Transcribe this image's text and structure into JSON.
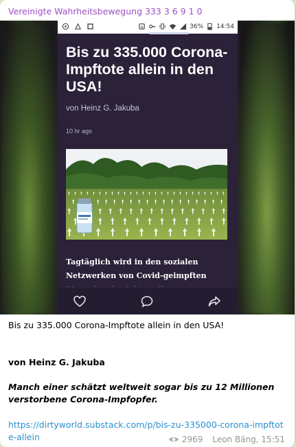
{
  "channel": {
    "name": "Vereinigte Wahrheitsbewegung 333 3 6 9 1 0"
  },
  "screenshot": {
    "status_bar": {
      "battery": "36%",
      "time": "14:54"
    },
    "article": {
      "headline": "Bis zu 335.000 Corona-Impftote allein in den USA!",
      "byline": "von Heinz G. Jakuba",
      "time_ago": "10 hr ago",
      "intro": "Tagtäglich wird in den sozialen Netzwerken von Covid-geimpften Menschen berichtet, die unerwartet plötzlich"
    },
    "actions": {
      "like_icon": "heart-icon",
      "comment_icon": "comment-icon",
      "share_icon": "share-icon"
    }
  },
  "caption": {
    "title": "Bis zu 335.000 Corona-Impftote allein in den USA!",
    "author": "von Heinz G. Jakuba",
    "quote": "Manch einer schätzt weltweit sogar bis zu 12 Millionen verstorbene Corona-Impfopfer.",
    "link": "https://dirtyworld.substack.com/p/bis-zu-335000-corona-impftote-allein"
  },
  "meta": {
    "views": "2969",
    "author_time": "Leon Bäng, 15:51"
  },
  "colors": {
    "channel_name": "#9c4fc2",
    "link": "#2a8fcf",
    "article_bg": "#2b2138",
    "meta": "#8e9b8a"
  }
}
